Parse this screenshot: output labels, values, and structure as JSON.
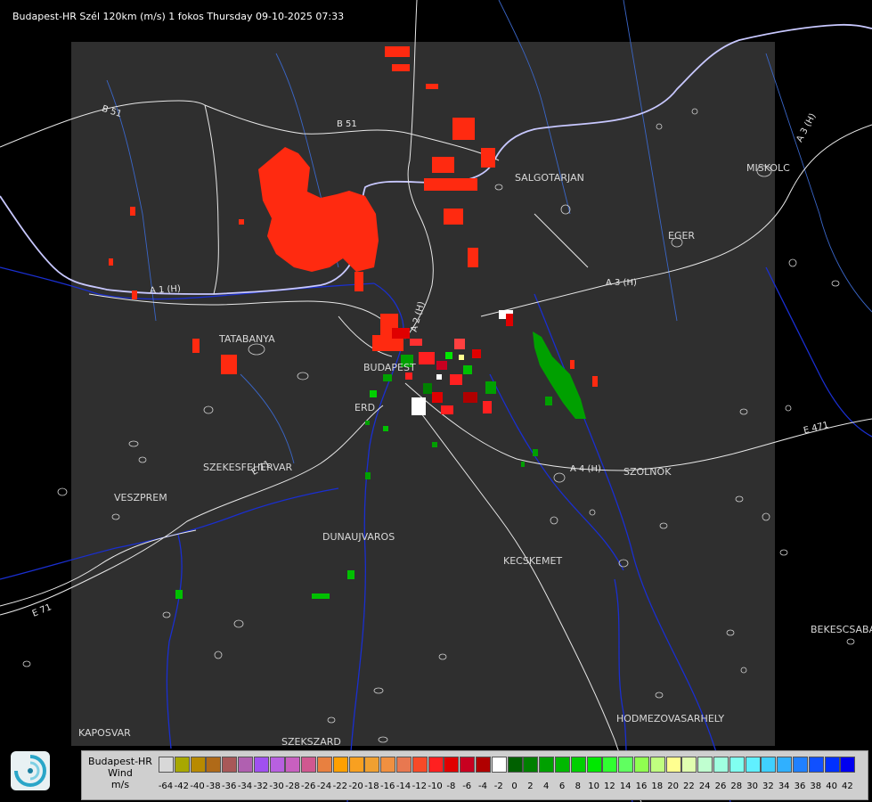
{
  "title": "Budapest-HR Szél 120km (m/s) 1 fokos Thursday 09-10-2025 07:33",
  "cities": [
    "SALGOTARJAN",
    "MISKOLC",
    "EGER",
    "TATABANYA",
    "BUDAPEST",
    "ERD",
    "SZEKESFEHERVAR",
    "VESZPREM",
    "DUNAUJVAROS",
    "KECSKEMET",
    "SZOLNOK",
    "BEKESCSABA",
    "KAPOSVAR",
    "SZEKSZARD",
    "HODMEZOVASARHELY"
  ],
  "roads": [
    "B 51",
    "B 51",
    "A 1 (H)",
    "A 2 (H)",
    "A 3 (H)",
    "A 3 (H)",
    "A 4 (H)",
    "E 71",
    "E 71",
    "E 471"
  ],
  "legend": {
    "line1": "Budapest-HR",
    "line2": "Wind",
    "line3": "m/s",
    "labels": [
      "-64",
      "-42",
      "-40",
      "-38",
      "-36",
      "-34",
      "-32",
      "-30",
      "-28",
      "-26",
      "-24",
      "-22",
      "-20",
      "-18",
      "-16",
      "-14",
      "-12",
      "-10",
      "-8",
      "-6",
      "-4",
      "-2",
      "0",
      "2",
      "4",
      "6",
      "8",
      "10",
      "12",
      "14",
      "16",
      "18",
      "20",
      "22",
      "24",
      "26",
      "28",
      "30",
      "32",
      "34",
      "36",
      "38",
      "40",
      "42"
    ],
    "colors": [
      "#d8d8d8",
      "#a8a800",
      "#b88a00",
      "#b06a18",
      "#a85858",
      "#b060b0",
      "#a050f0",
      "#b860e0",
      "#c860c0",
      "#d05890",
      "#e88040",
      "#ffa000",
      "#f8a020",
      "#f0a030",
      "#f09040",
      "#e87850",
      "#f84a28",
      "#ff2020",
      "#e00000",
      "#c80020",
      "#b00000",
      "#ffffff",
      "#006000",
      "#008000",
      "#00a000",
      "#00b800",
      "#00d000",
      "#00e800",
      "#30ff30",
      "#60ff60",
      "#90ff50",
      "#c0ff80",
      "#ffff90",
      "#e0ffb0",
      "#c0ffd0",
      "#a0ffe0",
      "#80fff0",
      "#60f0ff",
      "#40d0ff",
      "#30b0ff",
      "#2080ff",
      "#1050ff",
      "#0030ff",
      "#0000f0"
    ]
  }
}
